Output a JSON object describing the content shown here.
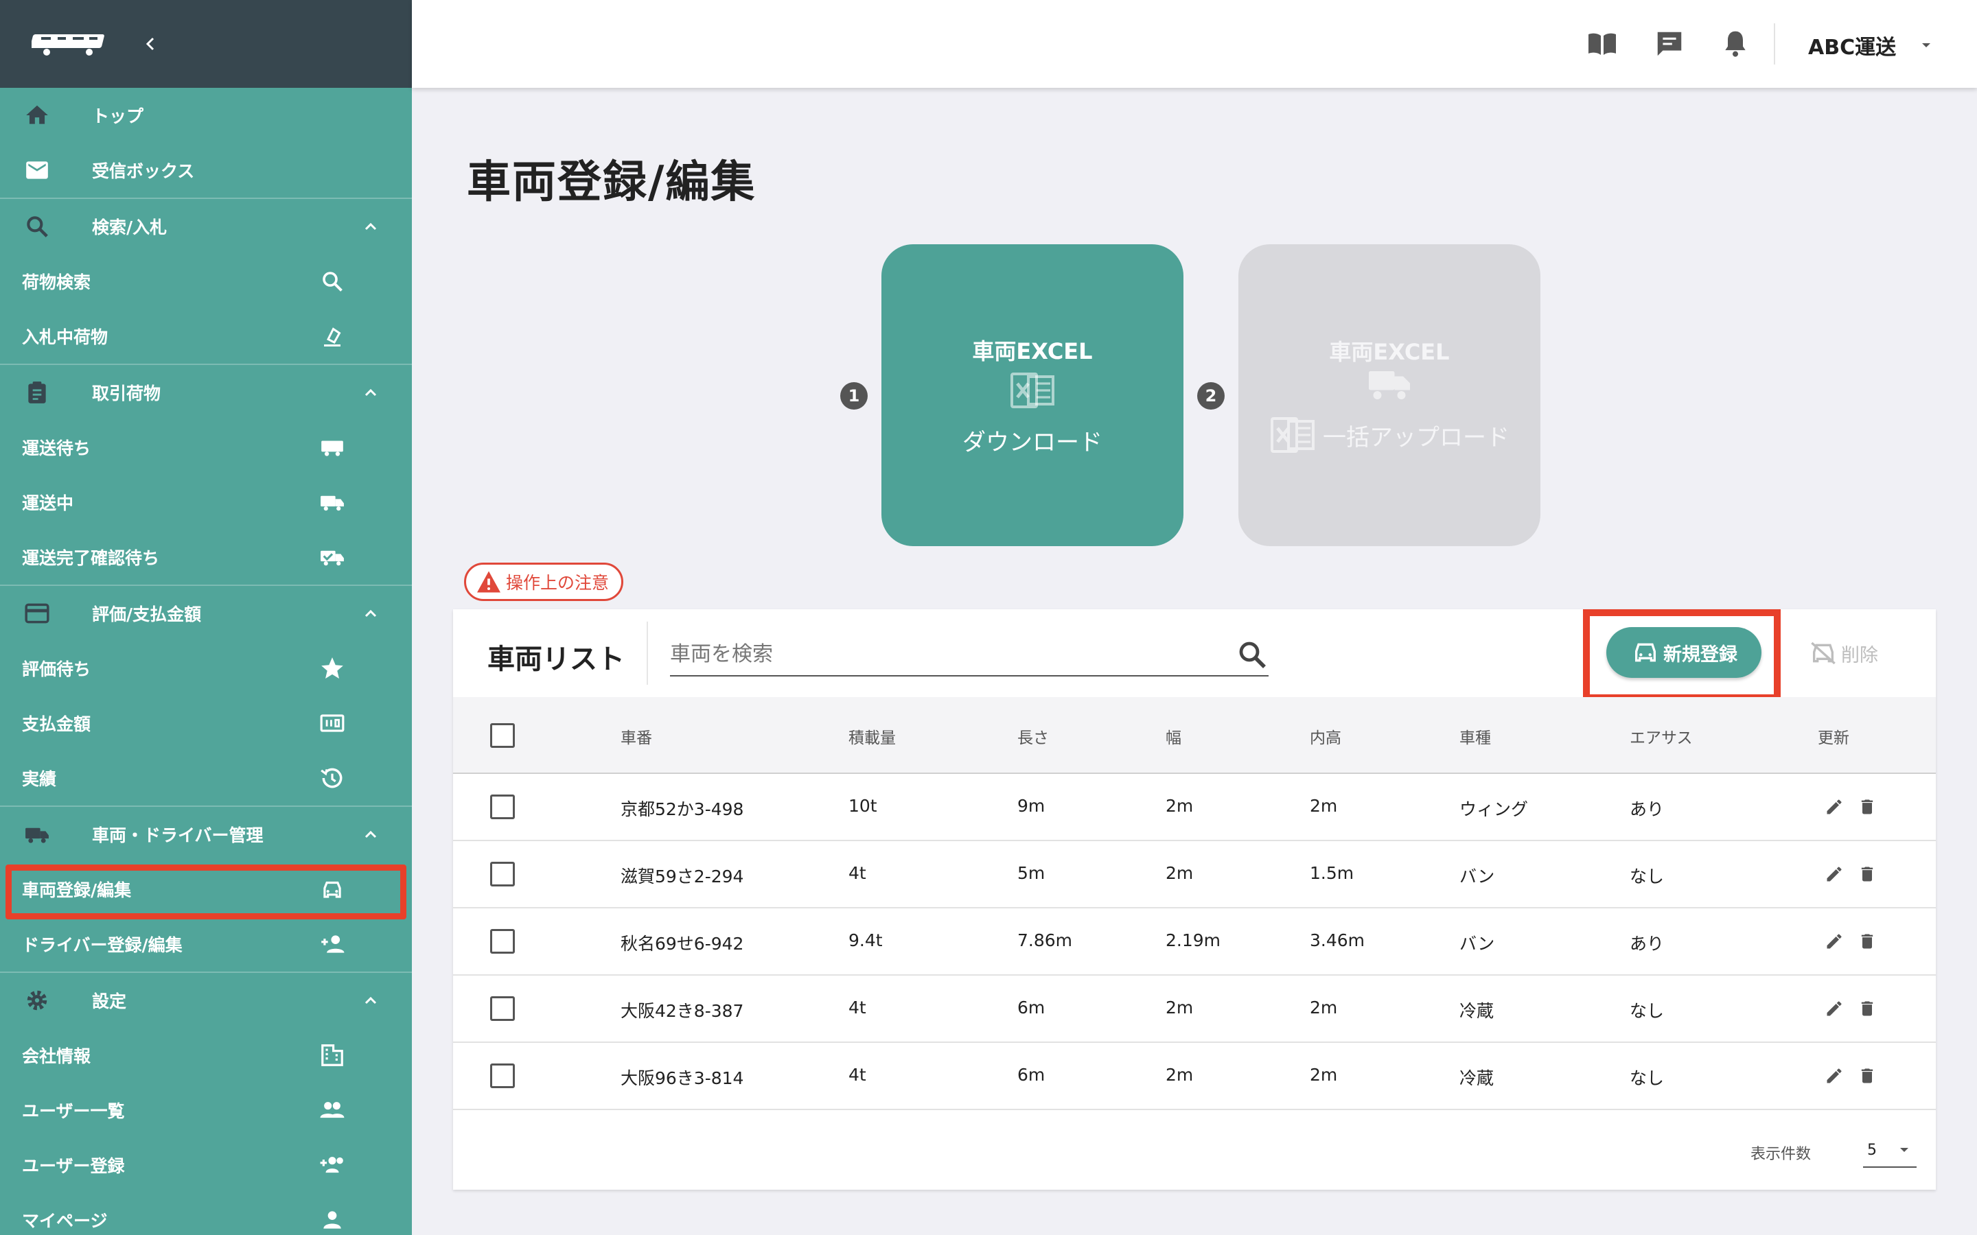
{
  "sidebar": {
    "top": "トップ",
    "inbox": "受信ボックス",
    "search_group": "検索/入札",
    "cargo_search": "荷物検索",
    "bidding_cargo": "入札中荷物",
    "trade_group": "取引荷物",
    "waiting_transport": "運送待ち",
    "in_transport": "運送中",
    "waiting_confirm": "運送完了確認待ち",
    "payment_group": "評価/支払金額",
    "waiting_review": "評価待ち",
    "payment_amount": "支払金額",
    "results": "実績",
    "vehicle_group": "車両・ドライバー管理",
    "vehicle_register": "車両登録/編集",
    "driver_register": "ドライバー登録/編集",
    "settings_group": "設定",
    "company_info": "会社情報",
    "user_list": "ユーザー一覧",
    "user_register": "ユーザー登録",
    "my_page": "マイページ"
  },
  "header": {
    "company": "ABC運送"
  },
  "page": {
    "title": "車両登録/編集",
    "step1": "1",
    "step2": "2",
    "download_title": "車両EXCEL",
    "download_label": "ダウンロード",
    "upload_title": "車両EXCEL",
    "upload_label": "一括アップロード",
    "caution": "操作上の注意"
  },
  "list": {
    "title": "車両リスト",
    "search_placeholder": "車両を検索",
    "new_button": "新規登録",
    "delete_button": "削除",
    "columns": [
      "車番",
      "積載量",
      "長さ",
      "幅",
      "内高",
      "車種",
      "エアサス",
      "更新"
    ],
    "rows": [
      [
        "京都52か3-498",
        "10t",
        "9m",
        "2m",
        "2m",
        "ウィング",
        "あり"
      ],
      [
        "滋賀59さ2-294",
        "4t",
        "5m",
        "2m",
        "1.5m",
        "バン",
        "なし"
      ],
      [
        "秋名69せ6-942",
        "9.4t",
        "7.86m",
        "2.19m",
        "3.46m",
        "バン",
        "あり"
      ],
      [
        "大阪42き8-387",
        "4t",
        "6m",
        "2m",
        "2m",
        "冷蔵",
        "なし"
      ],
      [
        "大阪96き3-814",
        "4t",
        "6m",
        "2m",
        "2m",
        "冷蔵",
        "なし"
      ]
    ],
    "per_page_label": "表示件数",
    "per_page_value": "5"
  },
  "colors": {
    "sidebar": "#51a59a",
    "accent": "#4ea297",
    "highlight": "#e8402a",
    "header_dark": "#37474f"
  }
}
